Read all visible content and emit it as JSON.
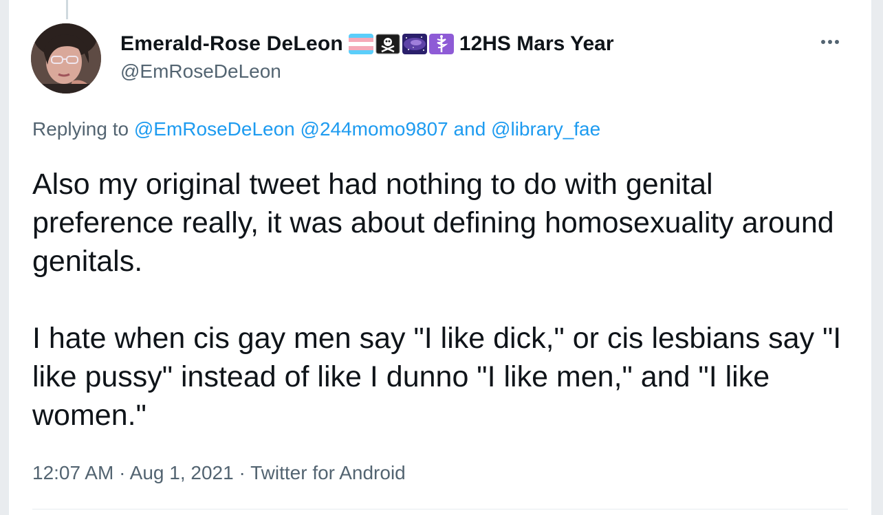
{
  "tweet": {
    "author": {
      "display_name": "Emerald-Rose DeLeon",
      "name_suffix": "12HS Mars Year",
      "handle": "@EmRoseDeLeon",
      "flag_icons": [
        "transgender-flag-icon",
        "pirate-flag-icon",
        "galaxy-icon",
        "medical-symbol-icon"
      ]
    },
    "reply": {
      "prefix": "Replying to",
      "mention_1": "@EmRoseDeLeon",
      "mention_2": "@244momo9807",
      "conjunction": "and",
      "mention_3": "@library_fae"
    },
    "text_paragraph_1": "Also my original tweet had nothing to do with genital preference really, it was about defining homosexuality around genitals.",
    "text_paragraph_2": "I hate when cis gay men say \"I like dick,\" or cis lesbians say \"I like pussy\" instead of like I dunno \"I like men,\" and \"I like women.\"",
    "meta": {
      "time": "12:07 AM",
      "separator": "·",
      "date": "Aug 1, 2021",
      "source": "Twitter for Android"
    },
    "more_icon": "ellipsis-icon"
  },
  "colors": {
    "text_primary": "#0f1419",
    "text_secondary": "#536471",
    "link": "#1d9bf0",
    "divider": "#e6ecf0"
  }
}
